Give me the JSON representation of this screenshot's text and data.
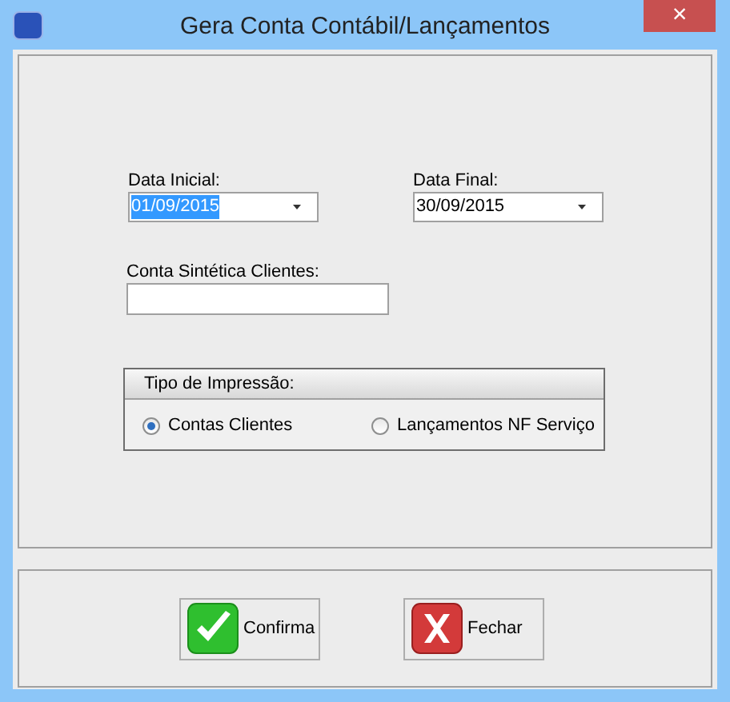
{
  "window": {
    "title": "Gera Conta Contábil/Lançamentos",
    "close": "×"
  },
  "fields": [
    {
      "label": "Data Inicial:",
      "value": "01/09/2015",
      "highlighted": true
    },
    {
      "label": "Data Final:",
      "value": "30/09/2015",
      "highlighted": false
    }
  ],
  "conta": {
    "label": "Conta Sintética Clientes:"
  },
  "tipo": {
    "title": "Tipo de Impressão:",
    "options": [
      {
        "label": "Contas Clientes",
        "selected": true
      },
      {
        "label": "Lançamentos NF Serviço",
        "selected": false
      }
    ]
  },
  "buttons": [
    {
      "label": "Confirma",
      "kind": "confirm"
    },
    {
      "label": "Fechar",
      "kind": "close"
    }
  ]
}
